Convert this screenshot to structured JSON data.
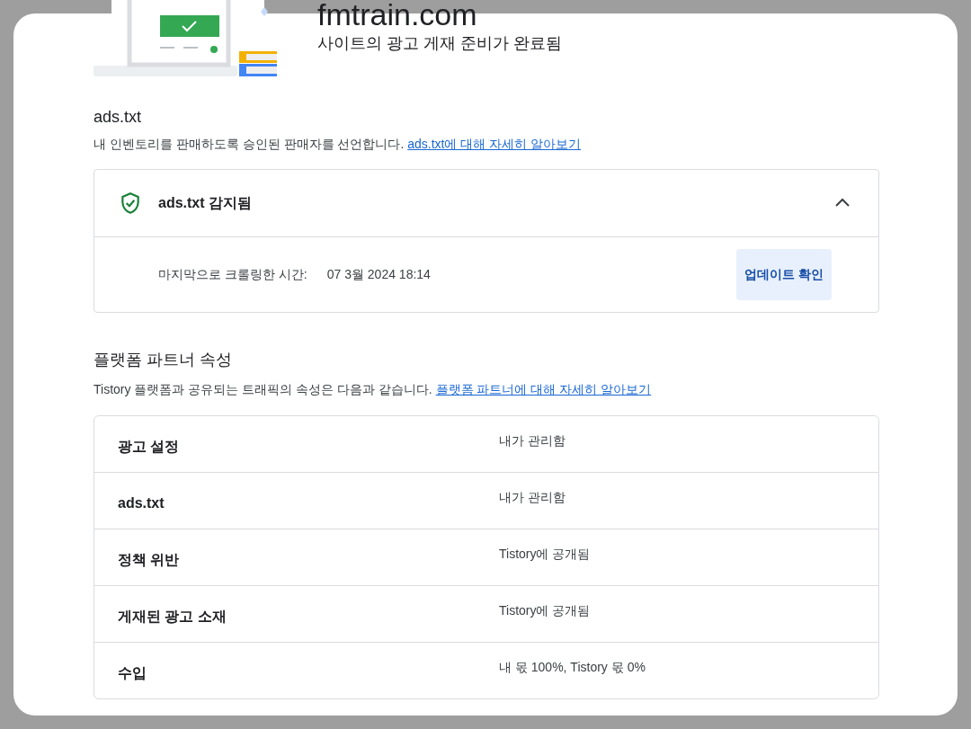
{
  "header": {
    "title": "fmtrain.com",
    "subtitle": "사이트의 광고 게재 준비가 완료됨"
  },
  "ads_txt": {
    "heading": "ads.txt",
    "description": "내 인벤토리를 판매하도록 승인된 판매자를 선언합니다.",
    "link": "ads.txt에 대해 자세히 알아보기",
    "status": {
      "label": "ads.txt 감지됨",
      "expanded": true
    },
    "last_crawled_label": "마지막으로 크롤링한 시간:",
    "last_crawled_value": "07 3월 2024 18:14",
    "button": "업데이트 확인"
  },
  "platform": {
    "heading": "플랫폼 파트너 속성",
    "description": "Tistory 플랫폼과 공유되는 트래픽의 속성은 다음과 같습니다.",
    "link": "플랫폼 파트너에 대해 자세히 알아보기",
    "rows": [
      {
        "label": "광고 설정",
        "value": "내가 관리함"
      },
      {
        "label": "ads.txt",
        "value": "내가 관리함"
      },
      {
        "label": "정책 위반",
        "value": "Tistory에 공개됨"
      },
      {
        "label": "게재된 광고 소재",
        "value": "Tistory에 공개됨"
      },
      {
        "label": "수입",
        "value": "내 몫 100%, Tistory 몫 0%"
      }
    ]
  }
}
